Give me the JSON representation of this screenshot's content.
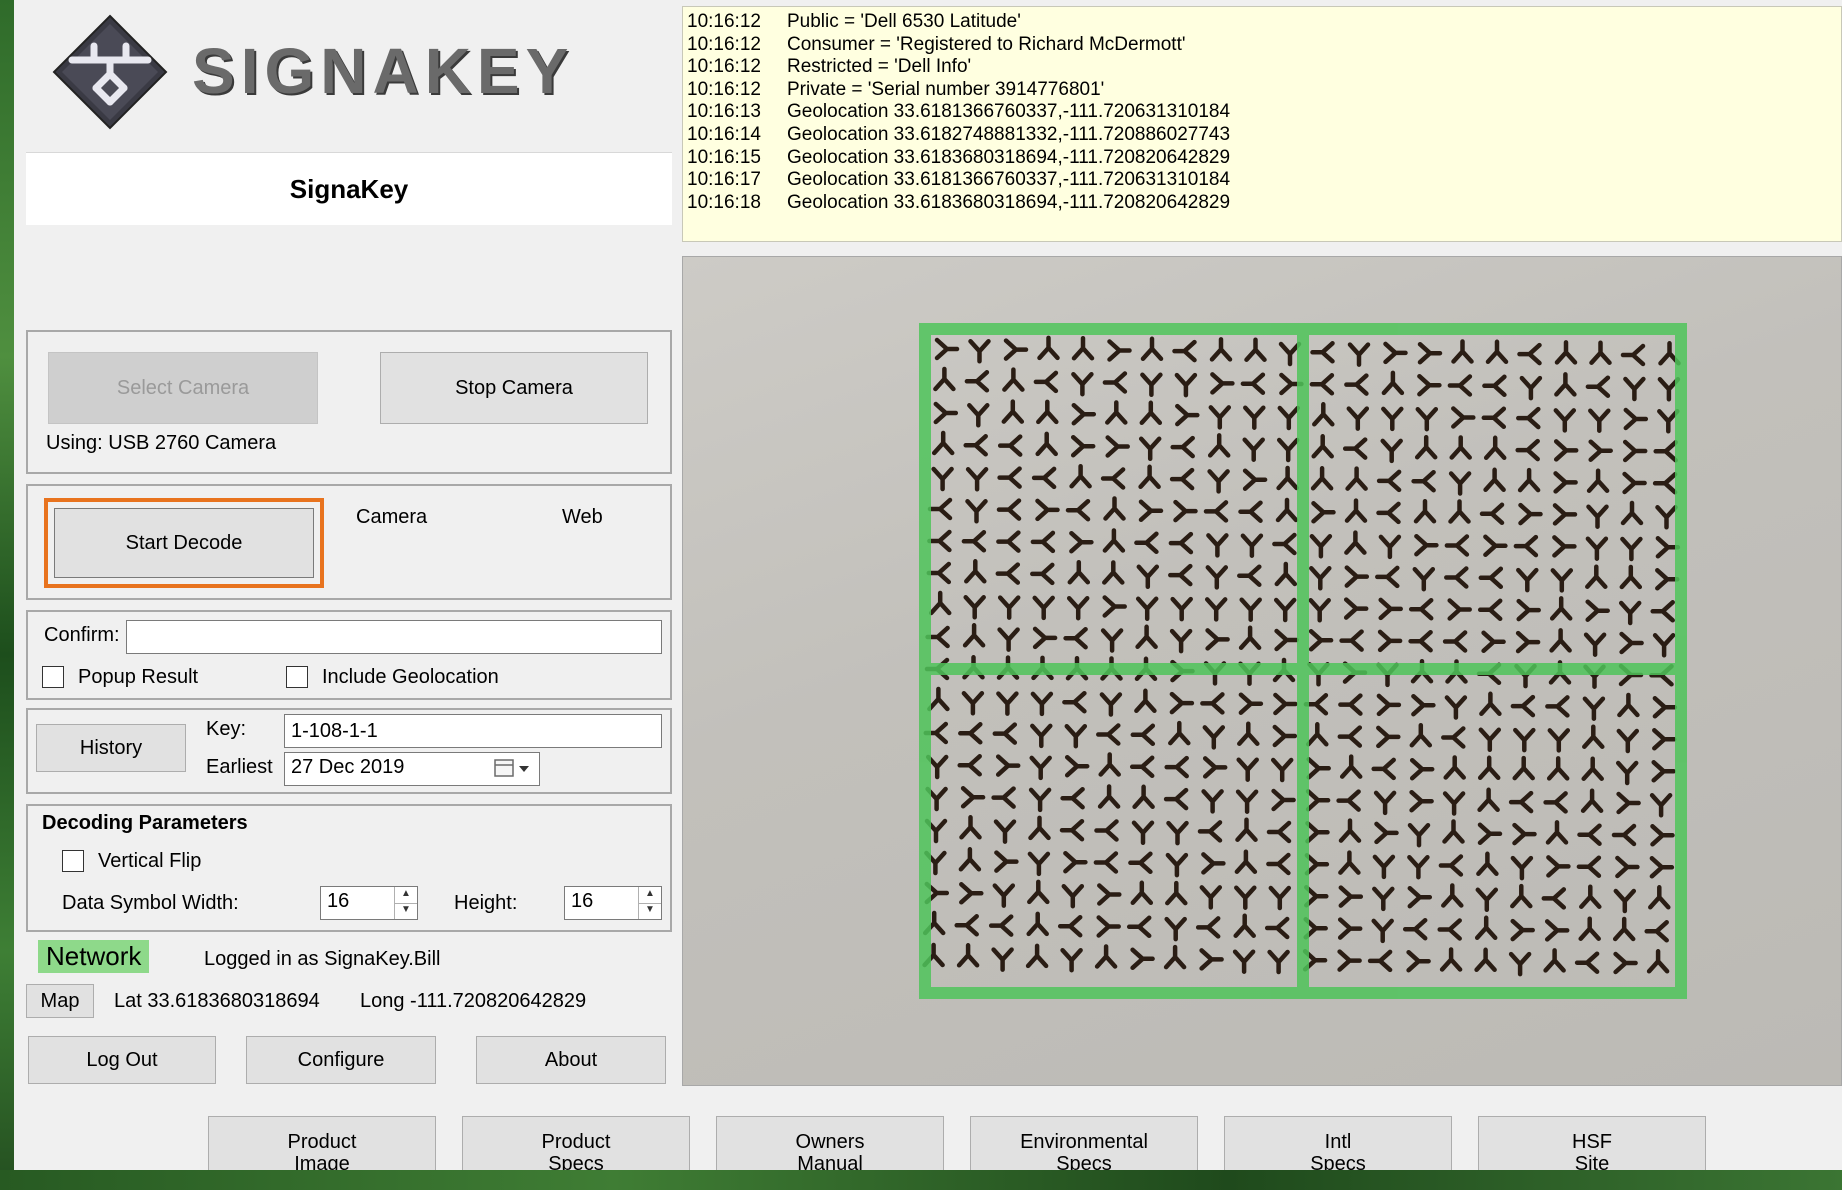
{
  "app": {
    "brand": "SignaKey",
    "logo_text": "SIGNAKEY",
    "title": "SignaKey",
    "accent_focus_color": "#e8731e",
    "network_color": "#8ed98a"
  },
  "camera_group": {
    "select_camera_label": "Select Camera",
    "stop_camera_label": "Stop Camera",
    "using_text": "Using: USB 2760 Camera"
  },
  "decode_group": {
    "start_decode_label": "Start Decode",
    "camera_option": "Camera",
    "web_option": "Web"
  },
  "confirm_group": {
    "confirm_label": "Confirm:",
    "confirm_value": "",
    "popup_result_label": "Popup Result",
    "popup_result_checked": false,
    "include_geolocation_label": "Include Geolocation",
    "include_geolocation_checked": false
  },
  "history_group": {
    "history_label": "History",
    "key_label": "Key:",
    "key_value": "1-108-1-1",
    "earliest_label": "Earliest",
    "earliest_value": "27 Dec 2019"
  },
  "params_group": {
    "title": "Decoding Parameters",
    "vertical_flip_label": "Vertical Flip",
    "vertical_flip_checked": false,
    "symbol_width_label": "Data Symbol Width:",
    "symbol_width_value": "16",
    "height_label": "Height:",
    "height_value": "16"
  },
  "status": {
    "network_label": "Network",
    "logged_in_text": "Logged in as SignaKey.Bill",
    "map_label": "Map",
    "lat_text": "Lat 33.6183680318694",
    "long_text": "Long -111.720820642829"
  },
  "footer_buttons": {
    "log_out": "Log Out",
    "configure": "Configure",
    "about": "About"
  },
  "log": [
    {
      "time": "10:16:12",
      "text": "Public = 'Dell 6530 Latitude'"
    },
    {
      "time": "10:16:12",
      "text": "Consumer = 'Registered to Richard McDermott'"
    },
    {
      "time": "10:16:12",
      "text": "Restricted = 'Dell Info'"
    },
    {
      "time": "10:16:12",
      "text": "Private = 'Serial number 3914776801'"
    },
    {
      "time": "10:16:13",
      "text": "Geolocation 33.6181366760337,-111.720631310184"
    },
    {
      "time": "10:16:14",
      "text": "Geolocation 33.6182748881332,-111.720886027743"
    },
    {
      "time": "10:16:15",
      "text": "Geolocation 33.6183680318694,-111.720820642829"
    },
    {
      "time": "10:16:17",
      "text": "Geolocation 33.6181366760337,-111.720631310184"
    },
    {
      "time": "10:16:18",
      "text": "Geolocation 33.6183680318694,-111.720820642829"
    }
  ],
  "camera_view": {
    "overlay_color": "#4fc45a",
    "symbol_color": "#2a1d14",
    "grid_columns": 22,
    "grid_rows": 20
  },
  "bottom_buttons": [
    {
      "line1": "Product",
      "line2": "Image"
    },
    {
      "line1": "Product",
      "line2": "Specs"
    },
    {
      "line1": "Owners",
      "line2": "Manual"
    },
    {
      "line1": "Environmental",
      "line2": "Specs"
    },
    {
      "line1": "Intl",
      "line2": "Specs"
    },
    {
      "line1": "HSF",
      "line2": "Site"
    }
  ]
}
